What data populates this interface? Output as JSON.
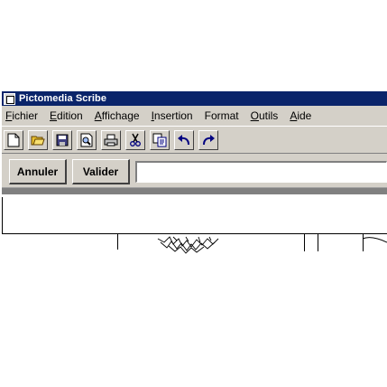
{
  "window": {
    "title": "Pictomedia Scribe"
  },
  "menu": [
    {
      "accel": "F",
      "rest": "ichier"
    },
    {
      "accel": "E",
      "rest": "dition"
    },
    {
      "accel": "A",
      "rest": "ffichage"
    },
    {
      "accel": "I",
      "rest": "nsertion"
    },
    {
      "accel": "",
      "rest": "Format"
    },
    {
      "accel": "O",
      "rest": "utils"
    },
    {
      "accel": "A",
      "rest": "ide"
    }
  ],
  "toolbar": {
    "icons": [
      "new-document-icon",
      "open-folder-icon",
      "save-icon",
      "print-preview-icon",
      "print-icon",
      "cut-icon",
      "copy-icon",
      "undo-icon",
      "redo-icon"
    ]
  },
  "editbar": {
    "cancel_label": "Annuler",
    "validate_label": "Valider",
    "input_value": ""
  },
  "colors": {
    "titlebar": "#0a246a",
    "chrome": "#d4d0c8"
  }
}
